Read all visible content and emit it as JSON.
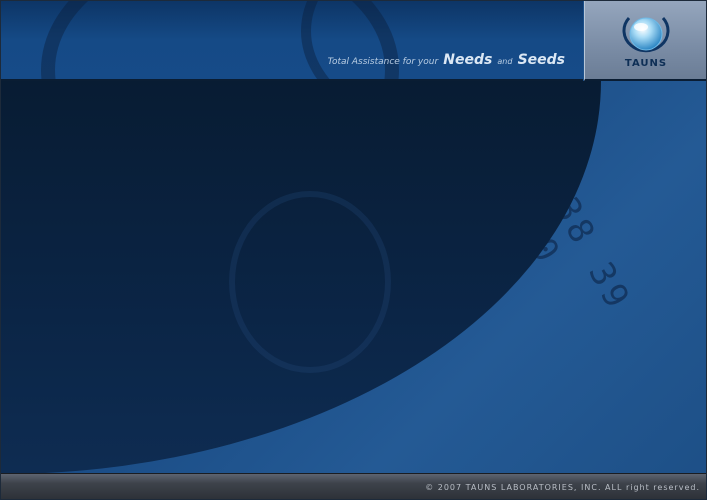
{
  "header": {
    "tagline_prefix": "Total Assistance for your",
    "tagline_word1": "Needs",
    "tagline_and": "and",
    "tagline_word2": "Seeds"
  },
  "logo": {
    "text": "TAUNS",
    "icon": "globe-icon"
  },
  "background": {
    "digits": "38 39 40"
  },
  "footer": {
    "copyright": "© 2007 TAUNS LABORATORIES, INC. ALL right reserved."
  },
  "colors": {
    "header_blue": "#154a86",
    "panel_navy": "#0b2546",
    "logo_box_gray": "#7a8ca5",
    "footer_gray": "#3e434b"
  }
}
